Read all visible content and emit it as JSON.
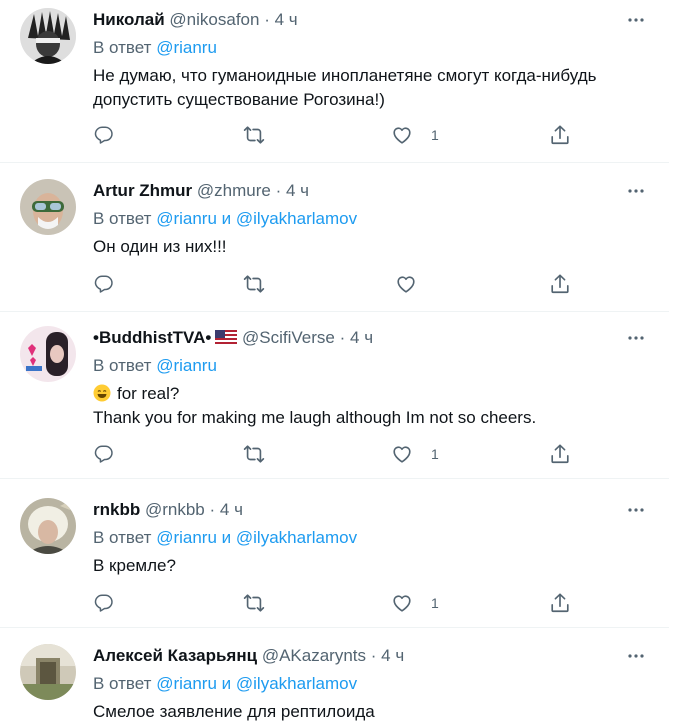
{
  "tweets": [
    {
      "name": "Николай",
      "handle": "@nikosafon",
      "time": "4 ч",
      "reply_prefix": "В ответ",
      "mention1": "@rianru",
      "joiner": "",
      "mention2": "",
      "text": "Не думаю, что гуманоидные инопланетяне смогут когда-нибудь допустить существование Рогозина!)",
      "like_count": "1"
    },
    {
      "name": "Artur Zhmur",
      "handle": "@zhmure",
      "time": "4 ч",
      "reply_prefix": "В ответ",
      "mention1": "@rianru",
      "joiner": "и",
      "mention2": "@ilyakharlamov",
      "text": "Он один из них!!!",
      "like_count": ""
    },
    {
      "name": "•BuddhistTVA•",
      "handle": "@ScifiVerse",
      "time": "4 ч",
      "reply_prefix": "В ответ",
      "mention1": "@rianru",
      "joiner": "",
      "mention2": "",
      "text_line1": "for real?",
      "text_line2": "Thank you for making me laugh although Im not so cheers.",
      "like_count": "1"
    },
    {
      "name": "rnkbb",
      "handle": "@rnkbb",
      "time": "4 ч",
      "reply_prefix": "В ответ",
      "mention1": "@rianru",
      "joiner": "и",
      "mention2": "@ilyakharlamov",
      "text": "В кремле?",
      "like_count": "1"
    },
    {
      "name": "Алексей Казарьянц",
      "handle": "@AKazarynts",
      "time": "4 ч",
      "reply_prefix": "В ответ",
      "mention1": "@rianru",
      "joiner": "и",
      "mention2": "@ilyakharlamov",
      "text": "Смелое заявление для рептилоида"
    }
  ],
  "icons": {
    "reply": "reply-icon",
    "retweet": "retweet-icon",
    "like": "heart-icon",
    "share": "share-icon",
    "more": "more-icon"
  },
  "colors": {
    "link": "#1d9bf0",
    "muted": "#536471",
    "text": "#0f1419",
    "divider": "#eff3f4"
  }
}
